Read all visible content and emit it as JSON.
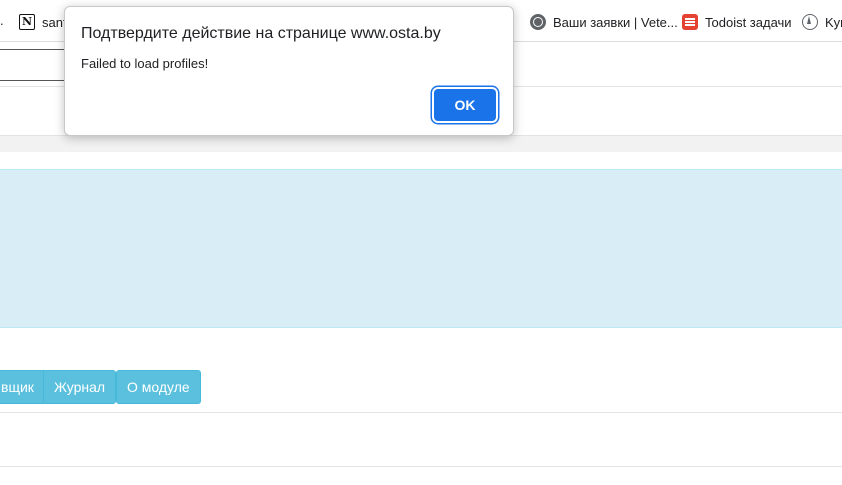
{
  "bookmarks": {
    "partial_left": ".",
    "items": [
      {
        "label": "sant",
        "icon": "notion-icon"
      },
      {
        "label": "Ваши заявки | Vete...",
        "icon": "globe-icon"
      },
      {
        "label": "Todoist задачи",
        "icon": "todoist-icon"
      },
      {
        "label": "Kyr",
        "icon": "compass-icon"
      }
    ]
  },
  "toolbar": {
    "buttons": [
      "вщик",
      "Журнал",
      "О модуле"
    ]
  },
  "dialog": {
    "title": "Подтвердите действие на странице www.osta.by",
    "message": "Failed to load profiles!",
    "ok_label": "OK"
  },
  "colors": {
    "info_panel": "#d9edf7",
    "button": "#5bc0de",
    "dialog_primary": "#1a73e8"
  }
}
